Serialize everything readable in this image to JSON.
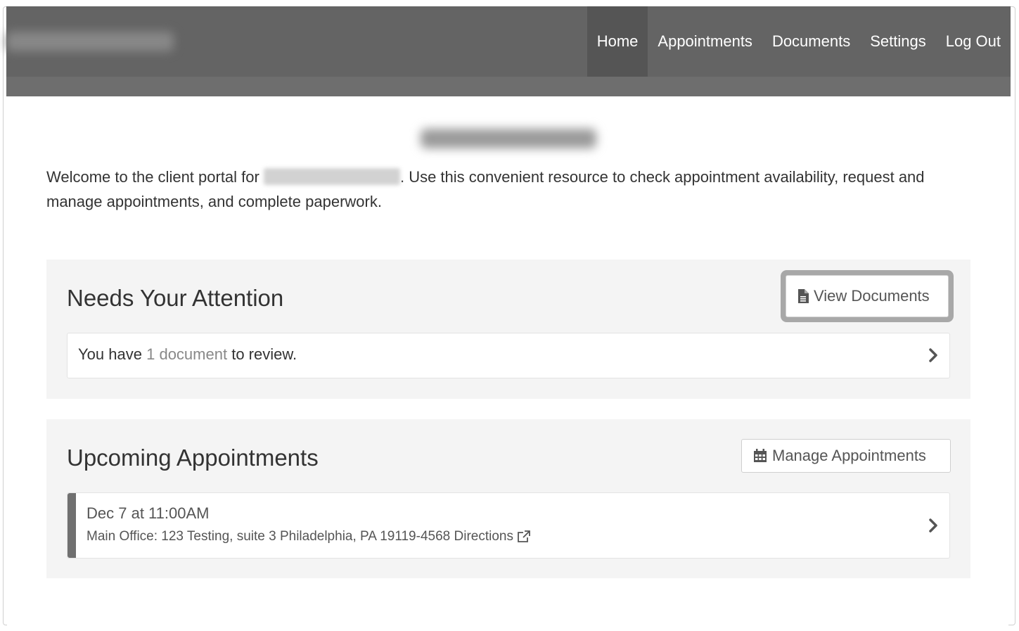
{
  "nav": {
    "items": [
      {
        "label": "Home",
        "active": true
      },
      {
        "label": "Appointments",
        "active": false
      },
      {
        "label": "Documents",
        "active": false
      },
      {
        "label": "Settings",
        "active": false
      },
      {
        "label": "Log Out",
        "active": false
      }
    ]
  },
  "welcome": {
    "before": "Welcome to the client portal for",
    "after": ". Use this convenient resource to check appointment availability, request and manage appointments, and complete paperwork."
  },
  "attention": {
    "title": "Needs Your Attention",
    "button_label": "View Documents",
    "button_icon": "file-icon",
    "row": {
      "prefix": "You have",
      "count": "1",
      "link": "document",
      "suffix": "to review."
    }
  },
  "appointments": {
    "title": "Upcoming Appointments",
    "button_label": "Manage Appointments",
    "button_icon": "calendar-icon",
    "items": [
      {
        "date": "Dec 7 at 11:00AM",
        "address": "Main Office: 123 Testing, suite 3 Philadelphia, PA 19119-4568",
        "directions": "Directions",
        "directions_icon": "external-link-icon"
      }
    ]
  },
  "colors": {
    "navbar": "#646464",
    "active_nav": "#555555",
    "panel_bg": "#f4f4f4",
    "link": "#888888"
  }
}
